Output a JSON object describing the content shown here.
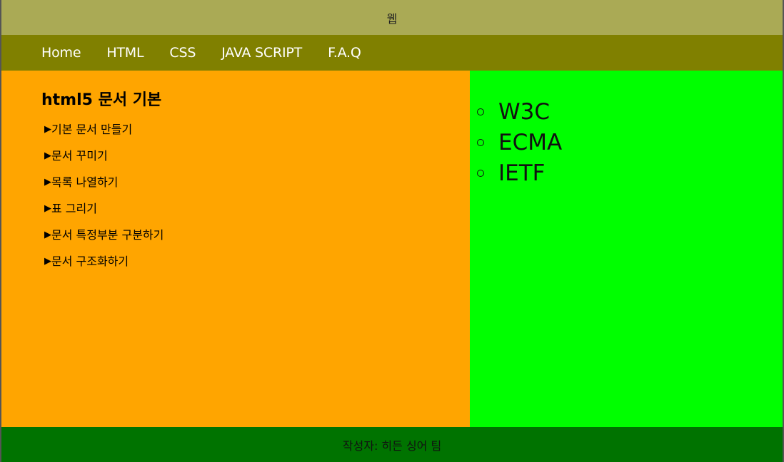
{
  "header": {
    "title": "웹"
  },
  "nav": {
    "items": [
      {
        "label": "Home"
      },
      {
        "label": "HTML"
      },
      {
        "label": "CSS"
      },
      {
        "label": "JAVA SCRIPT"
      },
      {
        "label": "F.A.Q"
      }
    ]
  },
  "left": {
    "heading": "html5 문서 기본",
    "items": [
      {
        "label": "기본 문서 만들기"
      },
      {
        "label": "문서 꾸미기"
      },
      {
        "label": "목록 나열하기"
      },
      {
        "label": "표 그리기"
      },
      {
        "label": "문서 특정부분 구분하기"
      },
      {
        "label": "문서 구조화하기"
      }
    ],
    "marker": "▶"
  },
  "right": {
    "items": [
      {
        "label": "W3C"
      },
      {
        "label": "ECMA"
      },
      {
        "label": "IETF"
      }
    ]
  },
  "footer": {
    "text": "작성자: 히든 싱어 팀"
  },
  "colors": {
    "header_bg": "#aaaa55",
    "nav_bg": "#808000",
    "left_bg": "#ffa500",
    "right_bg": "#00ff00",
    "footer_bg": "#007300"
  }
}
